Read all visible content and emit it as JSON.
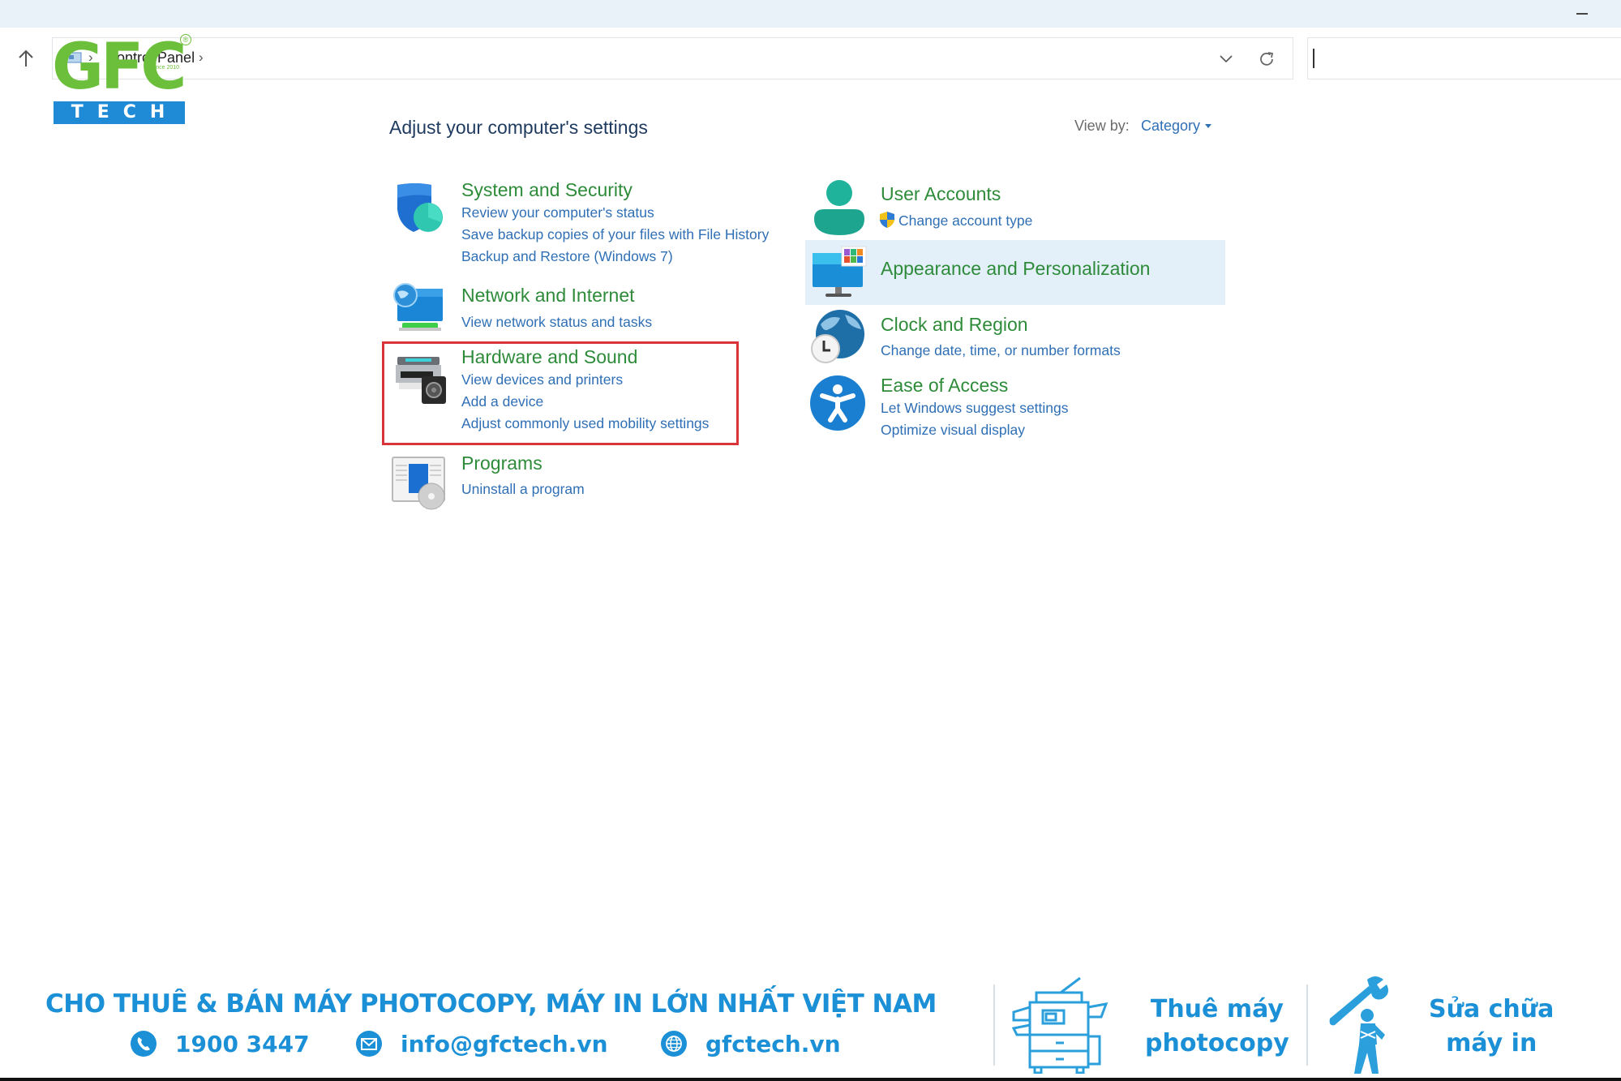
{
  "window": {
    "minimize_label": "Minimize"
  },
  "addressbar": {
    "breadcrumb": "Control Panel",
    "separator": "›",
    "dropdown_icon": "chevron-down-icon",
    "refresh_icon": "refresh-icon"
  },
  "search": {
    "value": "",
    "placeholder": ""
  },
  "logo": {
    "brand": "GFC",
    "sub": "TECH",
    "since": "Since 2010",
    "registered": "®"
  },
  "main": {
    "heading": "Adjust your computer's settings",
    "view_by_label": "View by:",
    "view_by_value": "Category"
  },
  "categories": {
    "system_security": {
      "title": "System and Security",
      "icon": "shield-icon",
      "links": [
        "Review your computer's status",
        "Save backup copies of your files with File History",
        "Backup and Restore (Windows 7)"
      ]
    },
    "network_internet": {
      "title": "Network and Internet",
      "icon": "network-globe-icon",
      "links": [
        "View network status and tasks"
      ]
    },
    "hardware_sound": {
      "title": "Hardware and Sound",
      "icon": "printer-speaker-icon",
      "links": [
        "View devices and printers",
        "Add a device",
        "Adjust commonly used mobility settings"
      ],
      "highlighted": true
    },
    "programs": {
      "title": "Programs",
      "icon": "programs-disc-icon",
      "links": [
        "Uninstall a program"
      ]
    },
    "user_accounts": {
      "title": "User Accounts",
      "icon": "user-icon",
      "links": [
        "Change account type"
      ],
      "link_icon": "uac-shield-icon"
    },
    "appearance": {
      "title": "Appearance and Personalization",
      "icon": "monitor-palette-icon",
      "links": [],
      "hovered": true
    },
    "clock_region": {
      "title": "Clock and Region",
      "icon": "globe-clock-icon",
      "links": [
        "Change date, time, or number formats"
      ]
    },
    "ease_access": {
      "title": "Ease of Access",
      "icon": "accessibility-icon",
      "links": [
        "Let Windows suggest settings",
        "Optimize visual display"
      ]
    }
  },
  "footer": {
    "headline": "CHO THUÊ & BÁN MÁY PHOTOCOPY, MÁY IN LỚN NHẤT VIỆT NAM",
    "phone": "1900 3447",
    "email": "info@gfctech.vn",
    "website": "gfctech.vn",
    "service1_line1": "Thuê máy",
    "service1_line2": "photocopy",
    "service2_line1": "Sửa chữa",
    "service2_line2": "máy in",
    "brand_color": "#1b90d6"
  },
  "colors": {
    "title_green": "#2e8b3a",
    "link_blue": "#2f6fb5",
    "highlight_red": "#d9343a",
    "hover_bg": "#e3eff9"
  }
}
